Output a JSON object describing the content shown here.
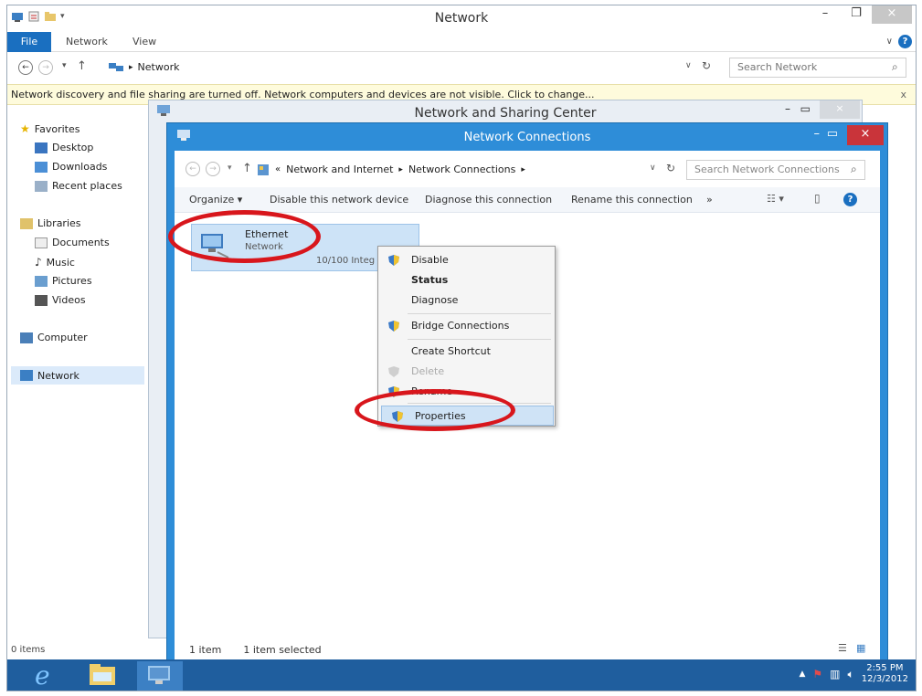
{
  "explorer": {
    "title": "Network",
    "tabs": {
      "file": "File",
      "network": "Network",
      "view": "View"
    },
    "address": {
      "location": "Network"
    },
    "search_placeholder": "Search Network",
    "infobar": "Network discovery and file sharing are turned off. Network computers and devices are not visible. Click to change...",
    "infobar_close": "x",
    "sidebar": {
      "favorites": "Favorites",
      "desktop": "Desktop",
      "downloads": "Downloads",
      "recent": "Recent places",
      "libraries": "Libraries",
      "documents": "Documents",
      "music": "Music",
      "pictures": "Pictures",
      "videos": "Videos",
      "computer": "Computer",
      "network": "Network"
    },
    "status": "0 items"
  },
  "sharing_center": {
    "title": "Network and Sharing Center"
  },
  "connections": {
    "title": "Network Connections",
    "breadcrumb": [
      "Network and Internet",
      "Network Connections"
    ],
    "search_placeholder": "Search Network Connections",
    "toolbar": {
      "organize": "Organize ▾",
      "disable": "Disable this network device",
      "diagnose": "Diagnose this connection",
      "rename": "Rename this connection",
      "more": "»"
    },
    "item": {
      "name": "Ethernet",
      "status": "Network",
      "adapter": "10/100 Integ"
    },
    "status_count": "1 item",
    "status_selected": "1 item selected"
  },
  "context_menu": {
    "disable": "Disable",
    "status": "Status",
    "diagnose": "Diagnose",
    "bridge": "Bridge Connections",
    "shortcut": "Create Shortcut",
    "delete": "Delete",
    "rename": "Rename",
    "properties": "Properties"
  },
  "taskbar": {
    "time": "2:55 PM",
    "date": "12/3/2012"
  },
  "colors": {
    "accent": "#1a6fc0",
    "window_border": "#2e8dd8",
    "annotation": "#d8161c",
    "close_button": "#c9343a",
    "taskbar": "#1f5e9e"
  }
}
